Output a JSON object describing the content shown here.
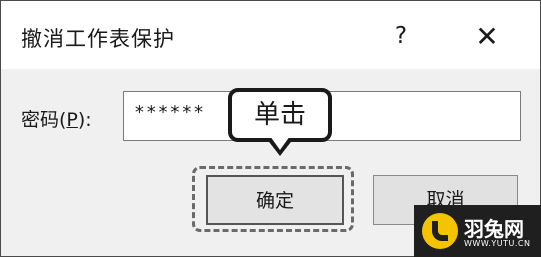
{
  "dialog": {
    "title": "撤消工作表保护",
    "help_label": "?",
    "close_label": "✕"
  },
  "password": {
    "label_prefix": "密码(",
    "label_key": "P",
    "label_suffix": "):",
    "value": "******"
  },
  "callout": {
    "text": "单击"
  },
  "buttons": {
    "ok_label": "确定",
    "cancel_label": "取消"
  },
  "watermark": {
    "name": "羽兔网",
    "url": "WWW.YUTU.CN"
  },
  "colors": {
    "dialog_bg": "#f0f0f0",
    "titlebar_bg": "#ffffff",
    "watermark_bg": "#1f1f1f",
    "watermark_logo": "#f5c400"
  }
}
